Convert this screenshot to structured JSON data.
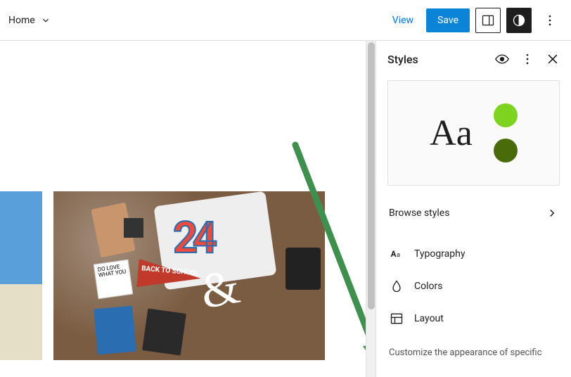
{
  "topbar": {
    "page_name": "Home",
    "view_label": "View",
    "save_label": "Save"
  },
  "sidebar": {
    "title": "Styles",
    "preview_text": "Aa",
    "browse_label": "Browse styles",
    "options": {
      "typography": "Typography",
      "colors": "Colors",
      "layout": "Layout"
    },
    "hint_text": "Customize the appearance of specific"
  },
  "canvas": {
    "image2": {
      "number": "24",
      "pennant": "BACK TO SCHOOL",
      "lovebox": "DO LOVE WHAT YOU"
    }
  },
  "colors": {
    "accent": "#0a84d6",
    "link": "#0073e6",
    "preview_light": "#7ed321",
    "preview_dark": "#4a6b0a",
    "arrow": "#3f8f4f"
  }
}
